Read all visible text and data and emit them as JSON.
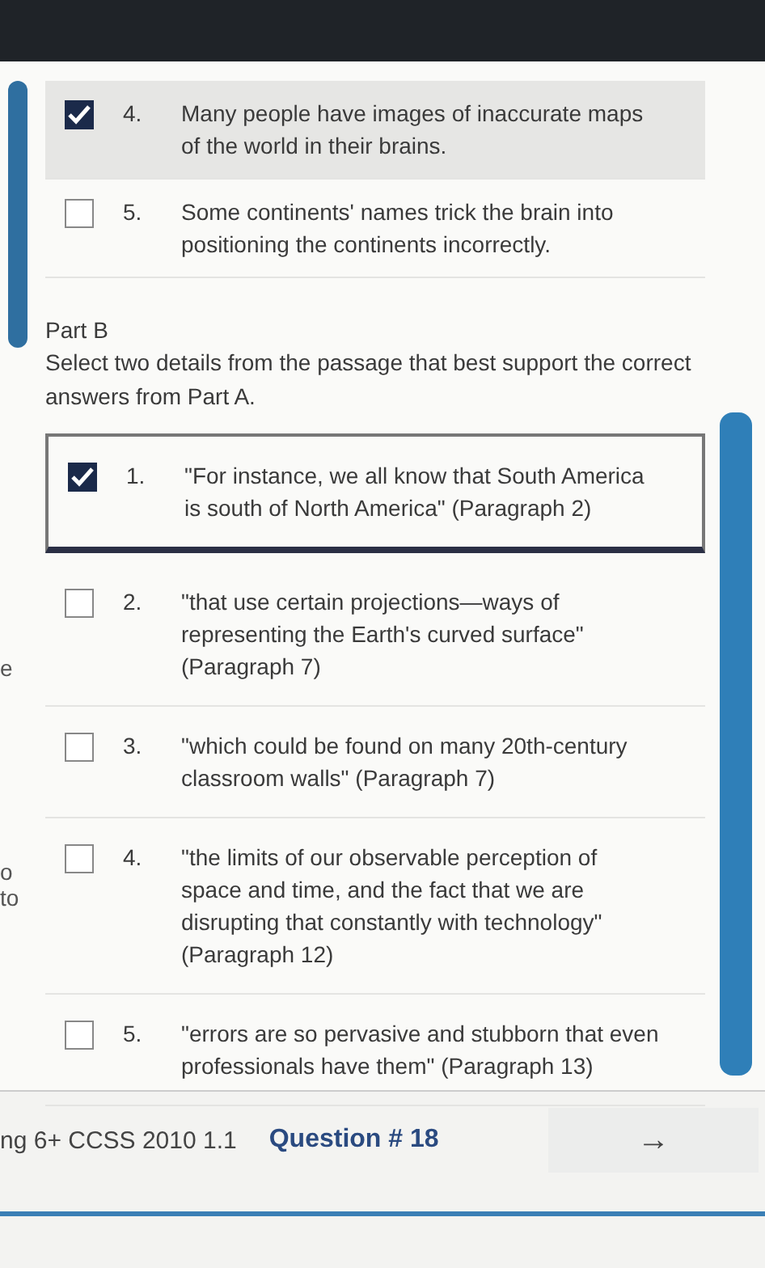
{
  "part_a_items": [
    {
      "number": "4.",
      "text": "Many people have images of inaccurate maps of the world in their brains.",
      "checked": true
    },
    {
      "number": "5.",
      "text": "Some continents' names trick the brain into positioning the continents incorrectly.",
      "checked": false
    }
  ],
  "part_b": {
    "heading": "Part B",
    "instruction": "Select two details from the passage that best support the correct answers from Part A.",
    "items": [
      {
        "number": "1.",
        "text": "\"For instance, we all know that South America is south of North America\" (Paragraph 2)",
        "checked": true
      },
      {
        "number": "2.",
        "text": "\"that use certain projections—ways of representing the Earth's curved surface\" (Paragraph 7)",
        "checked": false
      },
      {
        "number": "3.",
        "text": "\"which could be found on many 20th-century classroom walls\" (Paragraph 7)",
        "checked": false
      },
      {
        "number": "4.",
        "text": "\"the limits of our observable perception of space and time, and the fact that we are disrupting that constantly with technology\" (Paragraph 12)",
        "checked": false
      },
      {
        "number": "5.",
        "text": "\"errors are so pervasive and stubborn that even professionals have them\" (Paragraph 13)",
        "checked": false
      }
    ]
  },
  "side_fragments": [
    "e",
    "o",
    "to"
  ],
  "footer": {
    "standard": "ng 6+ CCSS 2010 1.1",
    "question": "Question # 18",
    "next_button": "→"
  }
}
